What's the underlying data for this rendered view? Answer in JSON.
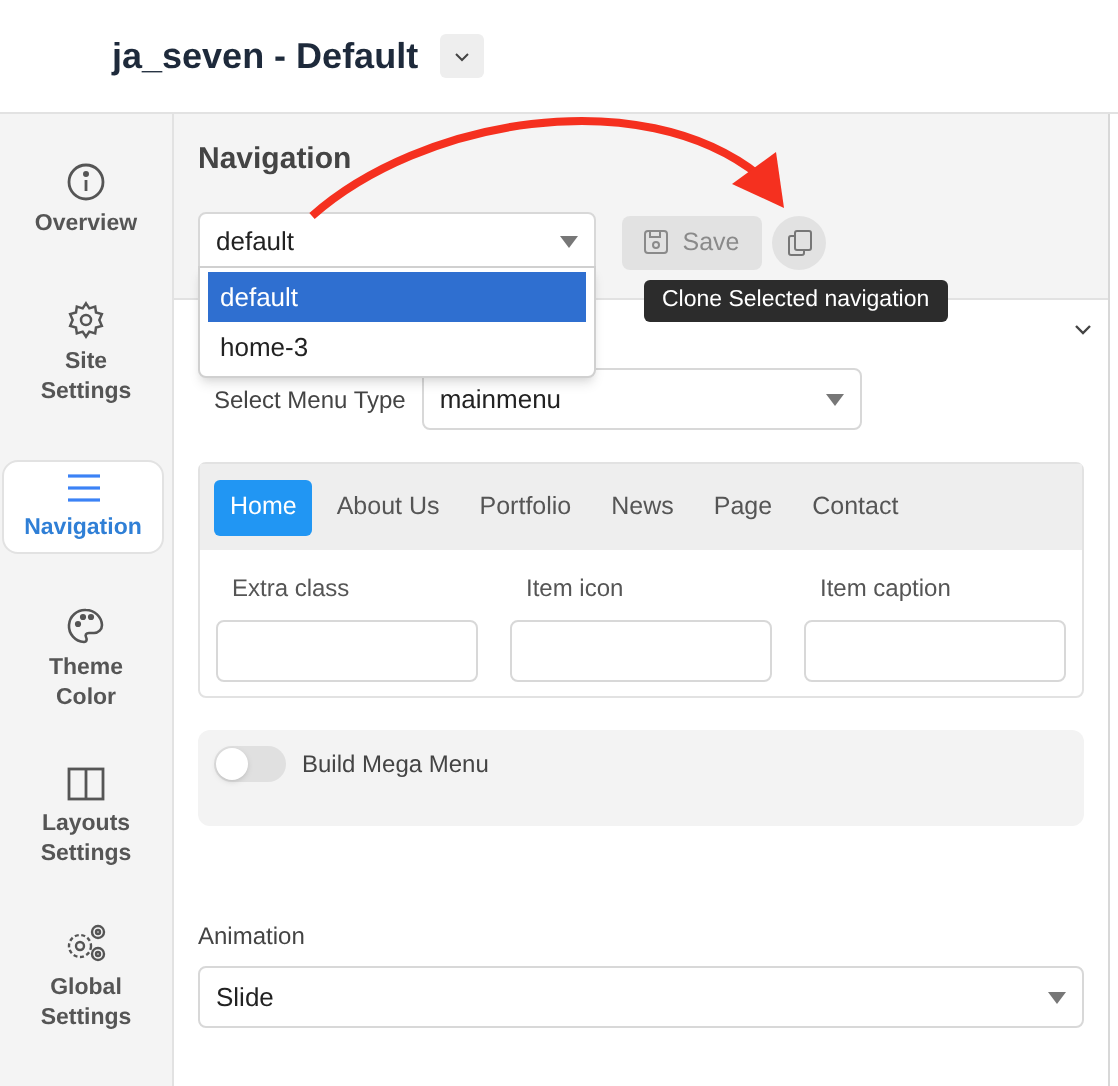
{
  "header": {
    "title": "ja_seven - Default"
  },
  "sidebar": {
    "items": [
      {
        "label": "Overview",
        "selected": false
      },
      {
        "label": "Site Settings",
        "selected": false
      },
      {
        "label": "Navigation",
        "selected": true
      },
      {
        "label": "Theme Color",
        "selected": false
      },
      {
        "label": "Layouts Settings",
        "selected": false
      },
      {
        "label": "Global Settings",
        "selected": false
      }
    ]
  },
  "main": {
    "heading": "Navigation",
    "navigation_select": {
      "value": "default",
      "options": [
        {
          "label": "default",
          "selected": true
        },
        {
          "label": "home-3",
          "selected": false
        }
      ]
    },
    "save_button": {
      "label": "Save",
      "disabled": true
    },
    "tooltip": "Clone Selected navigation",
    "menu_type": {
      "label": "Select Menu Type",
      "value": "mainmenu"
    },
    "menu_tabs": [
      {
        "label": "Home",
        "selected": true
      },
      {
        "label": "About Us",
        "selected": false
      },
      {
        "label": "Portfolio",
        "selected": false
      },
      {
        "label": "News",
        "selected": false
      },
      {
        "label": "Page",
        "selected": false
      },
      {
        "label": "Contact",
        "selected": false
      }
    ],
    "item_fields": [
      {
        "label": "Extra class"
      },
      {
        "label": "Item icon"
      },
      {
        "label": "Item caption"
      }
    ],
    "mega_menu": {
      "label": "Build Mega Menu",
      "on": false
    },
    "animation": {
      "label": "Animation",
      "value": "Slide"
    }
  }
}
